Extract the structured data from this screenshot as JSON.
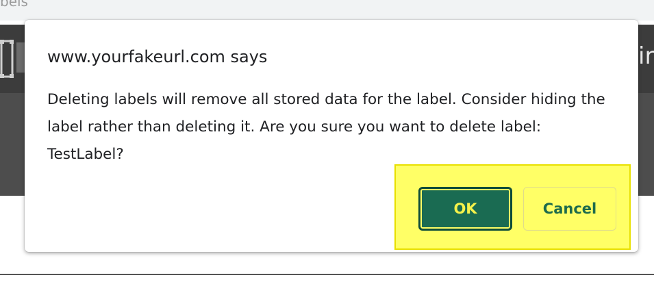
{
  "background": {
    "tab_text": "bels",
    "header_right_text": "ir"
  },
  "dialog": {
    "title": "www.yourfakeurl.com says",
    "message": "Deleting labels will remove all stored data for the label. Consider hiding the label rather than deleting it. Are you sure you want to delete label: TestLabel?",
    "ok_label": "OK",
    "cancel_label": "Cancel"
  },
  "colors": {
    "ok_button_bg": "#1a6b52",
    "highlight": "#ffff66",
    "header_bg": "#3c3c3c"
  }
}
